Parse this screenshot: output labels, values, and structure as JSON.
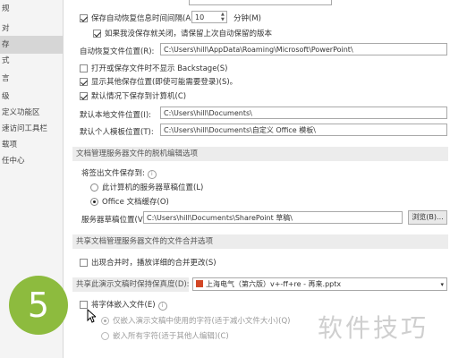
{
  "nav": {
    "items": [
      {
        "label": "规"
      },
      {
        "label": "对"
      },
      {
        "label": "存"
      },
      {
        "label": "式"
      },
      {
        "label": "言"
      },
      {
        "label": "级"
      },
      {
        "label": "定义功能区"
      },
      {
        "label": "速访问工具栏"
      },
      {
        "label": "载项"
      },
      {
        "label": "任中心"
      }
    ]
  },
  "save": {
    "autorecover_label": "保存自动恢复信息时间间隔(A)",
    "autorecover_minutes": "10",
    "minutes_unit": "分钟(M)",
    "keep_last_label": "如果我没保存就关闭，请保留上次自动保留的版本",
    "autorecover_location_label": "自动恢复文件位置(R):",
    "autorecover_location_value": "C:\\Users\\hill\\AppData\\Roaming\\Microsoft\\PowerPoint\\",
    "no_backstage_label": "打开或保存文件时不显示 Backstage(S)",
    "show_more_locations_label": "显示其他保存位置(即使可能需要登录)(S)。",
    "default_to_computer_label": "默认情况下保存到计算机(C)",
    "default_local_label": "默认本地文件位置(I):",
    "default_local_value": "C:\\Users\\hill\\Documents\\",
    "default_template_label": "默认个人模板位置(T):",
    "default_template_value": "C:\\Users\\hill\\Documents\\自定义 Office 模板\\"
  },
  "offline": {
    "section_title": "文档管理服务器文件的脱机编辑选项",
    "checkout_label": "将签出文件保存到:",
    "server_drafts_option": "此计算机的服务器草稿位置(L)",
    "office_cache_option": "Office 文档缓存(O)",
    "drafts_location_label": "服务器草稿位置(V):",
    "drafts_location_value": "C:\\Users\\hill\\Documents\\SharePoint 草稿\\",
    "browse_label": "浏览(B)..."
  },
  "merge": {
    "section_title": "共享文档管理服务器文件的文件合并选项",
    "show_merge_label": "出现合并时，播放详细的合并更改(S)"
  },
  "fidelity": {
    "section_title": "共享此演示文稿时保持保真度(D):",
    "file_name": "上海电气（第六版）v+-ff+re - 再来.pptx",
    "embed_fonts_label": "将字体嵌入文件(E)",
    "embed_used_only": "仅嵌入演示文稿中使用的字符(适于减小文件大小)(Q)",
    "embed_all": "嵌入所有字符(适于其他人编辑)(C)"
  },
  "overlay": {
    "step_number": "5",
    "watermark": "软件技巧"
  },
  "colors": {
    "badge": "#8dbb3e",
    "section_bg": "#ececec"
  }
}
